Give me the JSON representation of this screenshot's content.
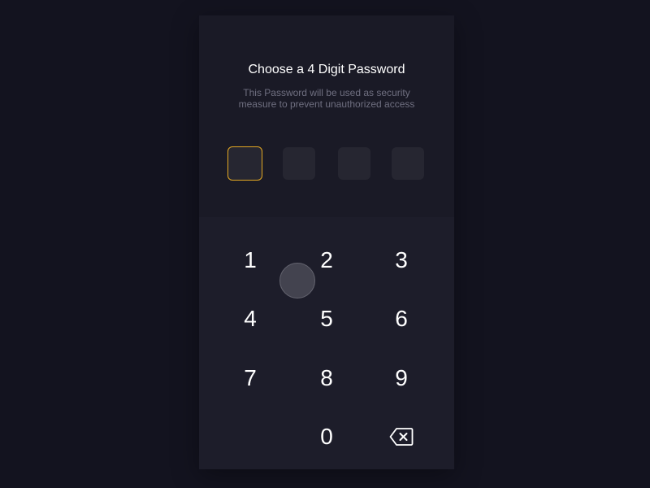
{
  "header": {
    "title": "Choose a 4 Digit Password",
    "subtitle": "This Password will be used as security measure to prevent unauthorized access"
  },
  "code": {
    "length": 4,
    "active_index": 0,
    "active_color": "#e3a822"
  },
  "keypad": {
    "keys": [
      "1",
      "2",
      "3",
      "4",
      "5",
      "6",
      "7",
      "8",
      "9",
      "0"
    ],
    "backspace_icon": "backspace-icon"
  }
}
